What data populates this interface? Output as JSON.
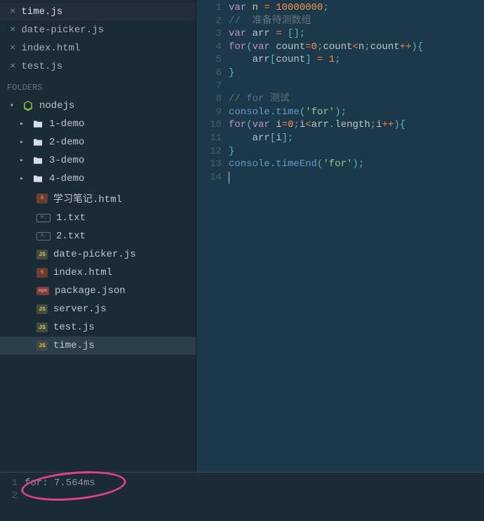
{
  "tabs": [
    {
      "label": "time.js",
      "active": true
    },
    {
      "label": "date-picker.js",
      "active": false
    },
    {
      "label": "index.html",
      "active": false
    },
    {
      "label": "test.js",
      "active": false
    }
  ],
  "foldersHeader": "FOLDERS",
  "rootFolder": "nodejs",
  "folders": [
    "1-demo",
    "2-demo",
    "3-demo",
    "4-demo"
  ],
  "files": [
    {
      "name": "学习笔记.html",
      "type": "html"
    },
    {
      "name": "1.txt",
      "type": "txt"
    },
    {
      "name": "2.txt",
      "type": "txt"
    },
    {
      "name": "date-picker.js",
      "type": "js"
    },
    {
      "name": "index.html",
      "type": "html"
    },
    {
      "name": "package.json",
      "type": "npm"
    },
    {
      "name": "server.js",
      "type": "js"
    },
    {
      "name": "test.js",
      "type": "js"
    },
    {
      "name": "time.js",
      "type": "js",
      "selected": true
    }
  ],
  "lineNumbers": [
    "1",
    "2",
    "3",
    "4",
    "5",
    "6",
    "7",
    "8",
    "9",
    "10",
    "11",
    "12",
    "13",
    "14"
  ],
  "code": [
    [
      {
        "t": "var",
        "c": "kw"
      },
      {
        "t": " n ",
        "c": "var"
      },
      {
        "t": "=",
        "c": "op"
      },
      {
        "t": " ",
        "c": "var"
      },
      {
        "t": "10000000",
        "c": "num"
      },
      {
        "t": ";",
        "c": "punc"
      }
    ],
    [
      {
        "t": "//  准备待测数组",
        "c": "comment"
      }
    ],
    [
      {
        "t": "var",
        "c": "kw"
      },
      {
        "t": " arr ",
        "c": "var"
      },
      {
        "t": "=",
        "c": "op"
      },
      {
        "t": " ",
        "c": "var"
      },
      {
        "t": "[]",
        "c": "punc"
      },
      {
        "t": ";",
        "c": "punc"
      }
    ],
    [
      {
        "t": "for",
        "c": "kw"
      },
      {
        "t": "(",
        "c": "punc"
      },
      {
        "t": "var",
        "c": "kw"
      },
      {
        "t": " count",
        "c": "var"
      },
      {
        "t": "=",
        "c": "op"
      },
      {
        "t": "0",
        "c": "num"
      },
      {
        "t": ";",
        "c": "punc"
      },
      {
        "t": "count",
        "c": "var"
      },
      {
        "t": "<",
        "c": "op"
      },
      {
        "t": "n",
        "c": "var"
      },
      {
        "t": ";",
        "c": "punc"
      },
      {
        "t": "count",
        "c": "var"
      },
      {
        "t": "++",
        "c": "op"
      },
      {
        "t": "){",
        "c": "punc"
      }
    ],
    [
      {
        "t": "    arr",
        "c": "var"
      },
      {
        "t": "[",
        "c": "punc"
      },
      {
        "t": "count",
        "c": "var"
      },
      {
        "t": "]",
        "c": "punc"
      },
      {
        "t": " ",
        "c": "var"
      },
      {
        "t": "=",
        "c": "op"
      },
      {
        "t": " ",
        "c": "var"
      },
      {
        "t": "1",
        "c": "num"
      },
      {
        "t": ";",
        "c": "punc"
      }
    ],
    [
      {
        "t": "}",
        "c": "punc"
      }
    ],
    [
      {
        "t": "",
        "c": "var"
      }
    ],
    [
      {
        "t": "// for 测试",
        "c": "comment"
      }
    ],
    [
      {
        "t": "console",
        "c": "obj"
      },
      {
        "t": ".",
        "c": "punc"
      },
      {
        "t": "time",
        "c": "obj"
      },
      {
        "t": "(",
        "c": "punc"
      },
      {
        "t": "'for'",
        "c": "str"
      },
      {
        "t": ");",
        "c": "punc"
      }
    ],
    [
      {
        "t": "for",
        "c": "kw"
      },
      {
        "t": "(",
        "c": "punc"
      },
      {
        "t": "var",
        "c": "kw"
      },
      {
        "t": " i",
        "c": "var"
      },
      {
        "t": "=",
        "c": "op"
      },
      {
        "t": "0",
        "c": "num"
      },
      {
        "t": ";",
        "c": "punc"
      },
      {
        "t": "i",
        "c": "var"
      },
      {
        "t": "<",
        "c": "op"
      },
      {
        "t": "arr",
        "c": "var"
      },
      {
        "t": ".",
        "c": "punc"
      },
      {
        "t": "length",
        "c": "ident"
      },
      {
        "t": ";",
        "c": "punc"
      },
      {
        "t": "i",
        "c": "var"
      },
      {
        "t": "++",
        "c": "op"
      },
      {
        "t": "){",
        "c": "punc"
      }
    ],
    [
      {
        "t": "    arr",
        "c": "var"
      },
      {
        "t": "[",
        "c": "punc"
      },
      {
        "t": "i",
        "c": "var"
      },
      {
        "t": "];",
        "c": "punc"
      }
    ],
    [
      {
        "t": "}",
        "c": "punc"
      }
    ],
    [
      {
        "t": "console",
        "c": "obj"
      },
      {
        "t": ".",
        "c": "punc"
      },
      {
        "t": "timeEnd",
        "c": "obj"
      },
      {
        "t": "(",
        "c": "punc"
      },
      {
        "t": "'for'",
        "c": "str"
      },
      {
        "t": ");",
        "c": "punc"
      }
    ],
    [
      {
        "t": "",
        "c": "var"
      }
    ]
  ],
  "consoleLines": [
    "1",
    "2"
  ],
  "consoleOutput": "for: 7.564ms",
  "icons": {
    "js": "JS",
    "html": "5",
    "txt": "M↓",
    "npm": "npm"
  }
}
